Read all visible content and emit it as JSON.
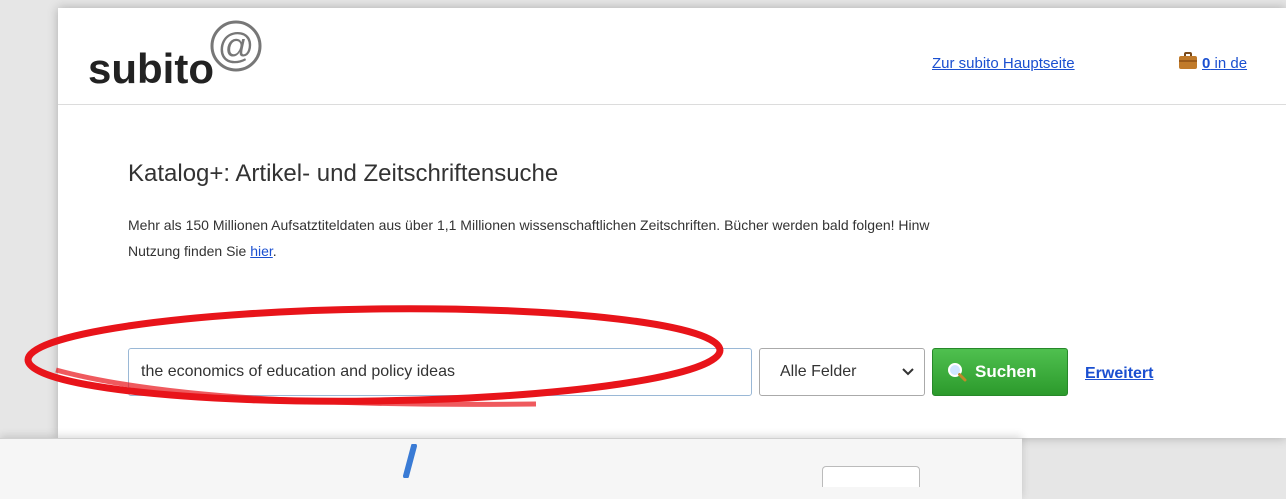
{
  "header": {
    "logo_text": "subito",
    "logo_symbol": "@",
    "main_link": "Zur subito Hauptseite",
    "cart_count": "0",
    "cart_text": "in de"
  },
  "main": {
    "title": "Katalog+: Artikel- und Zeitschriftensuche",
    "description_line1": "Mehr als 150 Millionen Aufsatztiteldaten aus über 1,1 Millionen wissenschaftlichen Zeitschriften. Bücher werden bald folgen! Hinw",
    "description_line2_prefix": "Nutzung finden Sie ",
    "description_link": "hier",
    "description_line2_suffix": "."
  },
  "search": {
    "query": "the economics of education and policy ideas",
    "field_selected": "Alle Felder",
    "button_label": "Suchen",
    "advanced_label": "Erweitert"
  },
  "colors": {
    "annotation": "#e8141a",
    "link": "#1a4fd0",
    "button": "#2c9a2c",
    "lower_stroke": "#3a7bd5"
  },
  "icons": [
    "at-icon",
    "briefcase-icon",
    "chevron-down-icon",
    "magnifier-icon"
  ]
}
